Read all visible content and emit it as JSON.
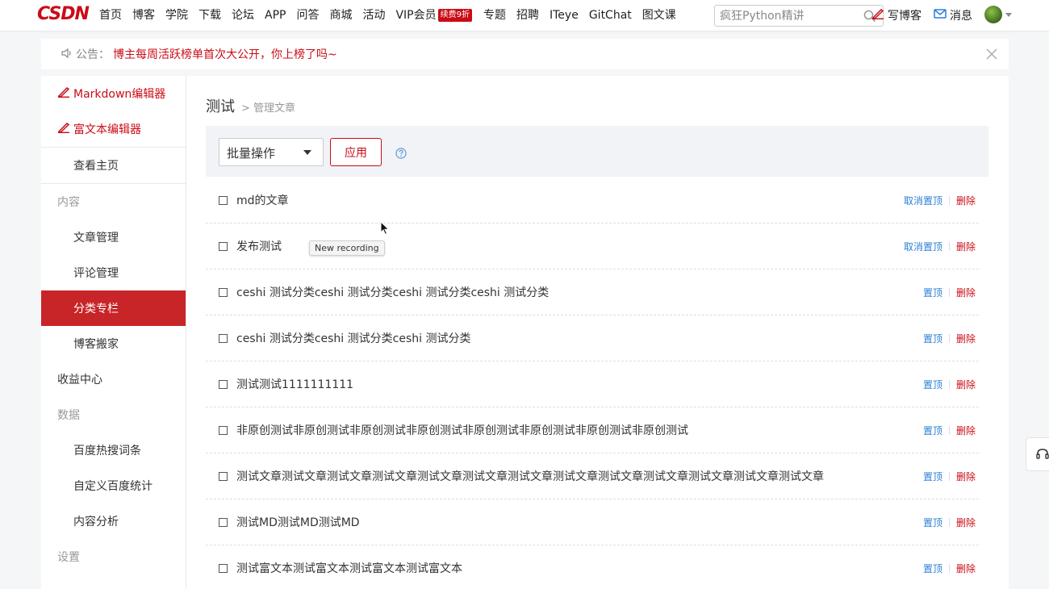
{
  "logo": "CSDN",
  "nav": {
    "links": [
      "首页",
      "博客",
      "学院",
      "下载",
      "论坛",
      "APP",
      "问答",
      "商城",
      "活动"
    ],
    "vip": "VIP会员",
    "vip_badge": "续费9折",
    "links2": [
      "专题",
      "招聘",
      "ITeye",
      "GitChat",
      "图文课"
    ],
    "search_placeholder": "疯狂Python精讲",
    "write": "写博客",
    "messages": "消息"
  },
  "notice": {
    "label": "公告：",
    "text": "博主每周活跃榜单首次大公开，你上榜了吗~"
  },
  "sidebar": {
    "editors": [
      "Markdown编辑器",
      "富文本编辑器"
    ],
    "view_home": "查看主页",
    "content_head": "内容",
    "content_items": [
      "文章管理",
      "评论管理",
      "分类专栏",
      "博客搬家"
    ],
    "income": "收益中心",
    "data_head": "数据",
    "data_items": [
      "百度热搜词条",
      "自定义百度统计",
      "内容分析"
    ],
    "settings_head": "设置"
  },
  "main": {
    "title": "测试",
    "crumb": "> 管理文章",
    "bulk_label": "批量操作",
    "apply_label": "应用"
  },
  "articles": [
    {
      "title": "md的文章",
      "pin": "取消置顶",
      "del": "删除"
    },
    {
      "title": "发布测试",
      "pin": "取消置顶",
      "del": "删除"
    },
    {
      "title": "ceshi 测试分类ceshi 测试分类ceshi 测试分类ceshi 测试分类",
      "pin": "置顶",
      "del": "删除"
    },
    {
      "title": "ceshi 测试分类ceshi 测试分类ceshi 测试分类",
      "pin": "置顶",
      "del": "删除"
    },
    {
      "title": "测试测试1111111111",
      "pin": "置顶",
      "del": "删除"
    },
    {
      "title": "非原创测试非原创测试非原创测试非原创测试非原创测试非原创测试非原创测试非原创测试",
      "pin": "置顶",
      "del": "删除"
    },
    {
      "title": "测试文章测试文章测试文章测试文章测试文章测试文章测试文章测试文章测试文章测试文章测试文章测试文章测试文章",
      "pin": "置顶",
      "del": "删除"
    },
    {
      "title": "测试MD测试MD测试MD",
      "pin": "置顶",
      "del": "删除"
    },
    {
      "title": "测试富文本测试富文本测试富文本测试富文本",
      "pin": "置顶",
      "del": "删除"
    }
  ],
  "tooltip": "New recording",
  "colors": {
    "brand": "#ca0c16",
    "link": "#2a7fd6",
    "active": "#c82528"
  }
}
